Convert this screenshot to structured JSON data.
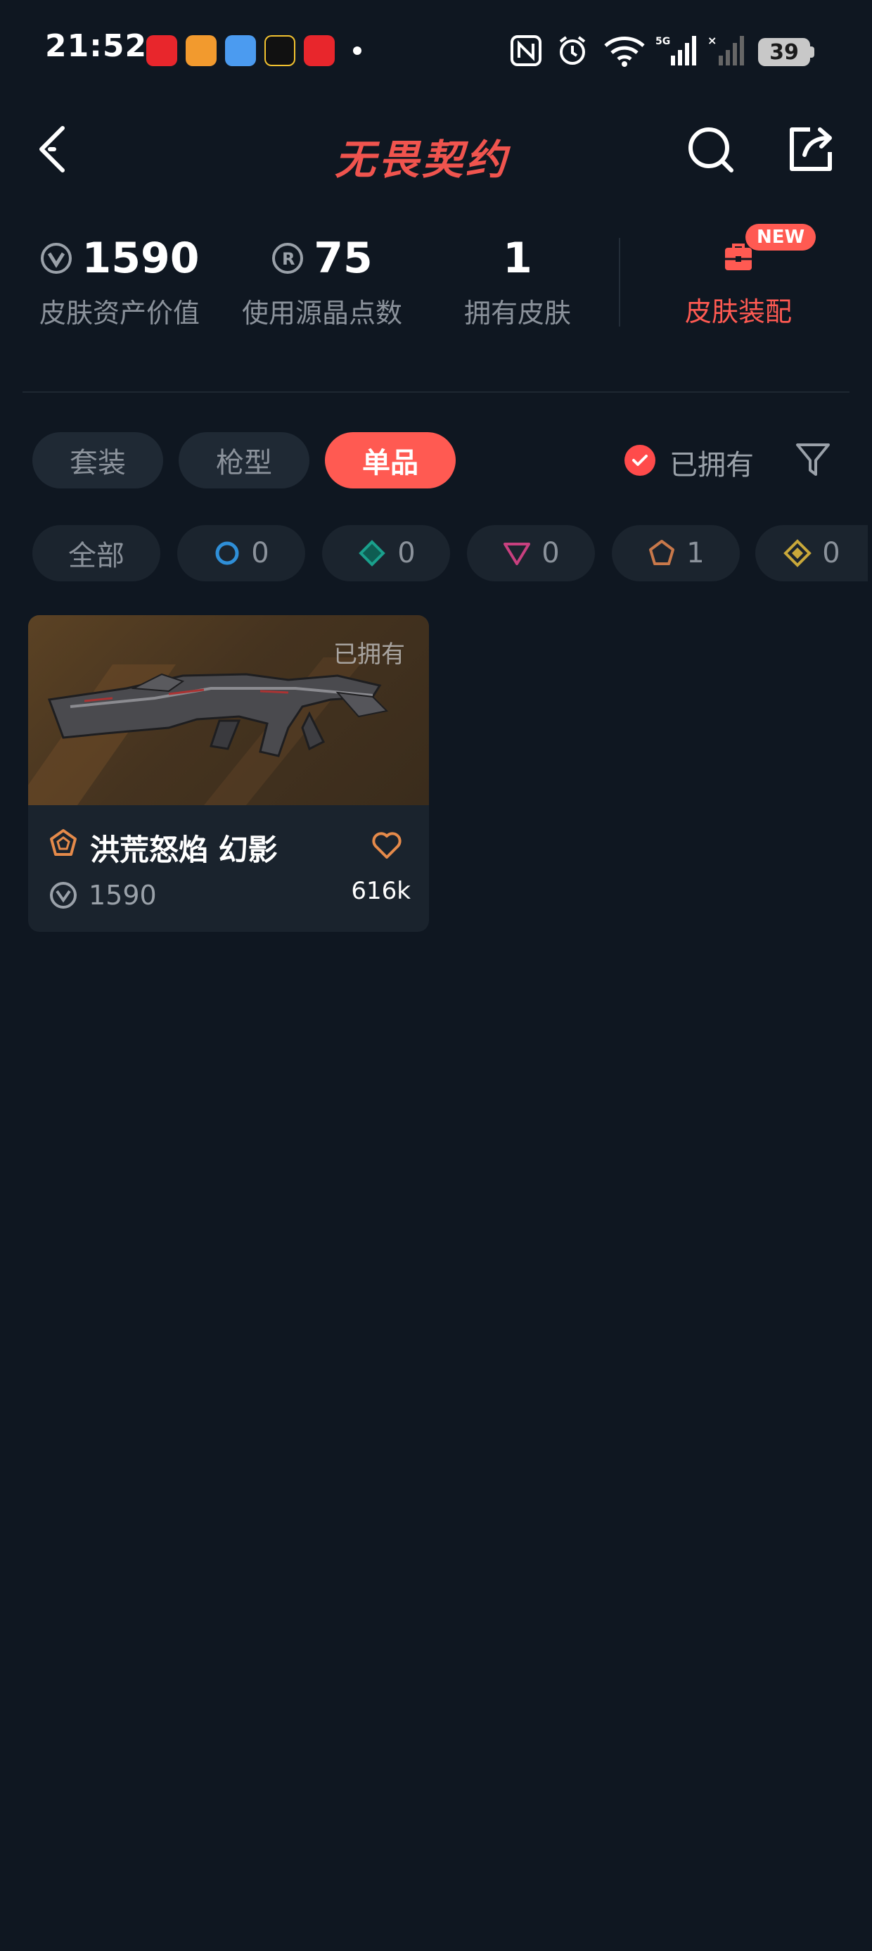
{
  "status_bar": {
    "time": "21:52",
    "battery": "39",
    "network": "5G"
  },
  "header": {
    "title": "无畏契约"
  },
  "stats": [
    {
      "value": "1590",
      "label": "皮肤资产价值",
      "icon": "vp-coin-icon"
    },
    {
      "value": "75",
      "label": "使用源晶点数",
      "icon": "radianite-icon"
    },
    {
      "value": "1",
      "label": "拥有皮肤",
      "icon": ""
    }
  ],
  "loadout": {
    "label": "皮肤装配",
    "badge": "NEW"
  },
  "tabs": [
    {
      "label": "套装",
      "active": false
    },
    {
      "label": "枪型",
      "active": false
    },
    {
      "label": "单品",
      "active": true
    }
  ],
  "filters": {
    "owned_label": "已拥有",
    "owned_checked": true
  },
  "rarity_chips": [
    {
      "label": "全部",
      "icon": ""
    },
    {
      "count": "0",
      "icon": "select-tier-icon",
      "color": "#2f8fd8"
    },
    {
      "count": "0",
      "icon": "deluxe-tier-icon",
      "color": "#1aa08c"
    },
    {
      "count": "0",
      "icon": "premium-tier-icon",
      "color": "#c8407f"
    },
    {
      "count": "1",
      "icon": "exclusive-tier-icon",
      "color": "#c8784a"
    },
    {
      "count": "0",
      "icon": "ultra-tier-icon",
      "color": "#c9a83a"
    }
  ],
  "skins": [
    {
      "name": "洪荒怒焰 幻影",
      "price": "1590",
      "likes": "616k",
      "owned_tag": "已拥有",
      "tier_color": "#e58a4a"
    }
  ],
  "colors": {
    "accent": "#ff5a52",
    "background": "#0f1721"
  }
}
